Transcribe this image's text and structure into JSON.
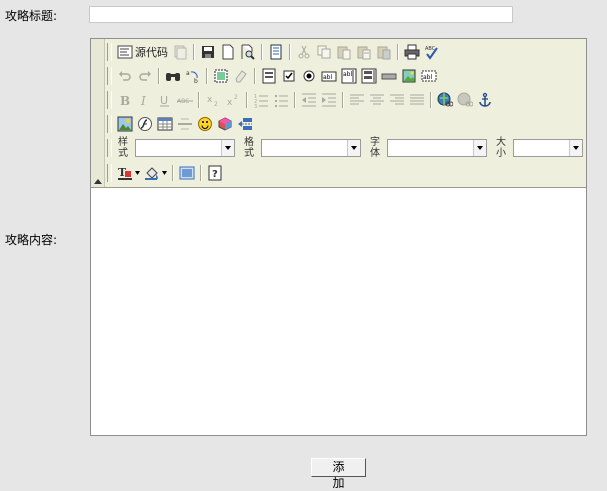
{
  "form": {
    "title_label": "攻略标题:",
    "title_value": "",
    "content_label": "攻略内容:",
    "submit_label": "添 加"
  },
  "editor": {
    "source_button_label": "源代码",
    "dropdowns": {
      "style": {
        "label_top": "样",
        "label_bottom": "式",
        "value": ""
      },
      "format": {
        "label_top": "格",
        "label_bottom": "式",
        "value": ""
      },
      "font": {
        "label_top": "字",
        "label_bottom": "体",
        "value": ""
      },
      "size": {
        "label_top": "大",
        "label_bottom": "小",
        "value": ""
      }
    },
    "icons": {
      "row1": [
        "source-icon",
        "new-page-icon",
        "save-icon",
        "new-document-icon",
        "preview-icon",
        "templates-icon",
        "cut-icon",
        "copy-icon",
        "paste-icon",
        "paste-text-icon",
        "paste-word-icon",
        "print-icon",
        "spellcheck-icon"
      ],
      "row2": [
        "undo-icon",
        "redo-icon",
        "find-icon",
        "replace-icon",
        "select-all-icon",
        "remove-format-icon",
        "form-icon",
        "checkbox-icon",
        "radio-icon",
        "textfield-icon",
        "textarea-icon",
        "select-field-icon",
        "button-field-icon",
        "image-button-icon",
        "hidden-field-icon"
      ],
      "row3": [
        "bold-icon",
        "italic-icon",
        "underline-icon",
        "strikethrough-icon",
        "subscript-icon",
        "superscript-icon",
        "ordered-list-icon",
        "unordered-list-icon",
        "outdent-icon",
        "indent-icon",
        "align-left-icon",
        "align-center-icon",
        "align-right-icon",
        "align-justify-icon",
        "link-icon",
        "unlink-icon",
        "anchor-icon"
      ],
      "row4": [
        "image-icon",
        "flash-icon",
        "table-icon",
        "horizontal-rule-icon",
        "smiley-icon",
        "special-char-icon",
        "page-break-icon"
      ],
      "row6": [
        "text-color-icon",
        "background-color-icon",
        "show-blocks-icon",
        "about-icon"
      ]
    }
  }
}
